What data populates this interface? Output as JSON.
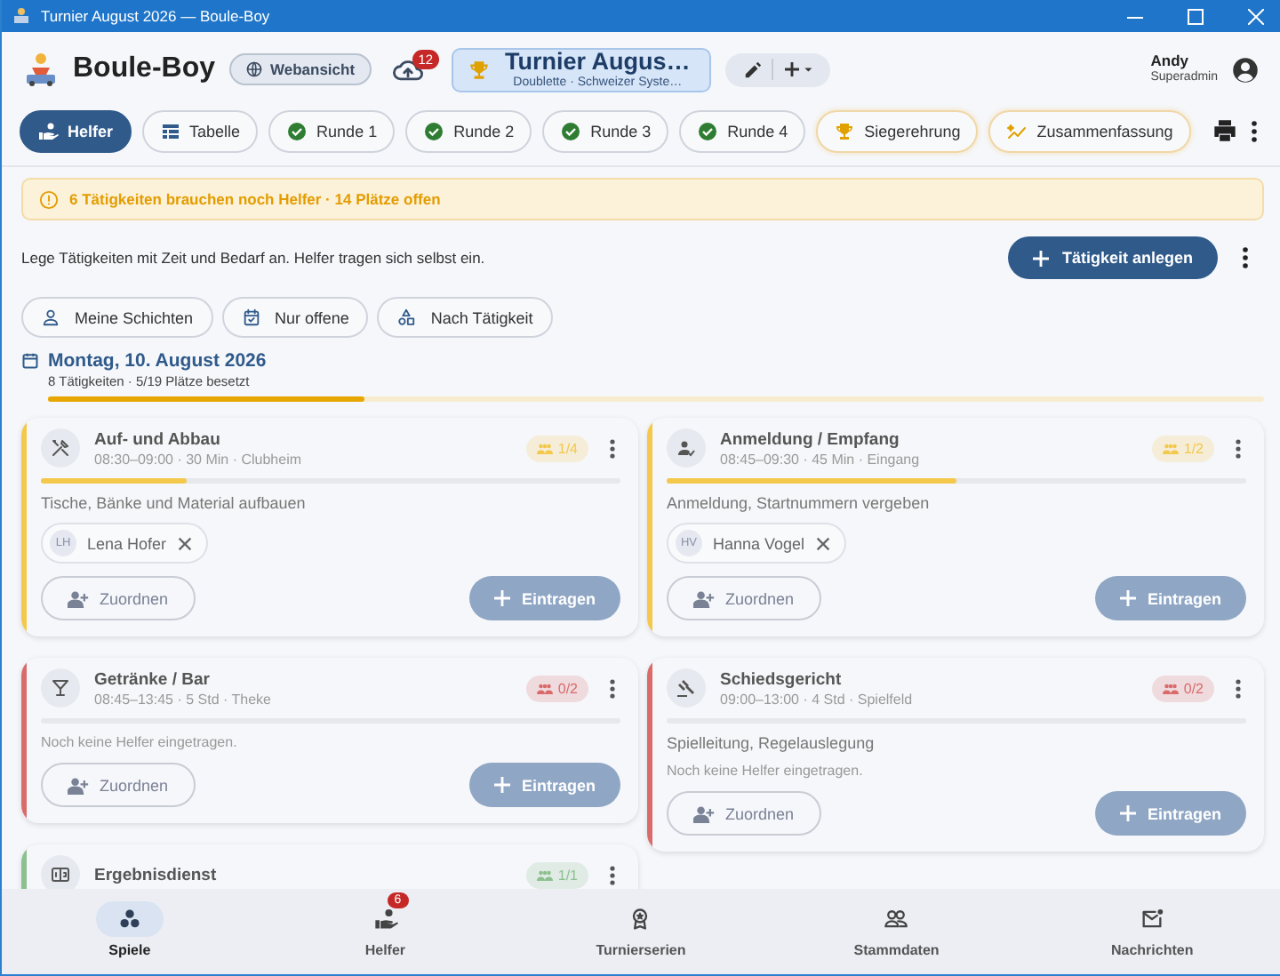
{
  "window": {
    "title": "Turnier August 2026 — Boule-Boy"
  },
  "header": {
    "app_name": "Boule-Boy",
    "web_button": "Webansicht",
    "sync_badge": "12",
    "tournament": {
      "title": "Turnier Augus…",
      "subtitle": "Doublette · Schweizer Syste…"
    },
    "user": {
      "name": "Andy",
      "role": "Superadmin"
    }
  },
  "tabs": [
    {
      "label": "Helfer",
      "kind": "helper",
      "selected": true
    },
    {
      "label": "Tabelle",
      "kind": "table",
      "selected": false
    },
    {
      "label": "Runde 1",
      "kind": "done",
      "selected": false
    },
    {
      "label": "Runde 2",
      "kind": "done",
      "selected": false
    },
    {
      "label": "Runde 3",
      "kind": "done",
      "selected": false
    },
    {
      "label": "Runde 4",
      "kind": "done",
      "selected": false
    },
    {
      "label": "Siegerehrung",
      "kind": "trophy",
      "selected": false
    },
    {
      "label": "Zusammenfassung",
      "kind": "summary",
      "selected": false
    }
  ],
  "alert": "6 Tätigkeiten brauchen noch Helfer · 14 Plätze offen",
  "intro": "Lege Tätigkeiten mit Zeit und Bedarf an. Helfer tragen sich selbst ein.",
  "add_button": "Tätigkeit anlegen",
  "filters": [
    {
      "label": "Meine Schichten",
      "kind": "person"
    },
    {
      "label": "Nur offene",
      "kind": "calendar"
    },
    {
      "label": "Nach Tätigkeit",
      "kind": "shapes"
    }
  ],
  "day": {
    "title": "Montag, 10. August 2026",
    "summary": "8 Tätigkeiten · 5/19 Plätze besetzt",
    "level": 0.26
  },
  "columns": [
    {
      "activities": [
        {
          "kind": "tools",
          "title": "Auf- und Abbau",
          "meta": "08:30–09:00 · 30 Min · Clubheim",
          "color": "#f4c84a",
          "count": "1/4",
          "level": 0.25,
          "description": "Tische, Bänke und Material aufbauen",
          "helpers": [
            {
              "initials": "LH",
              "name": "Lena Hofer"
            }
          ],
          "assign": "Zuordnen",
          "signup": "Eintragen"
        },
        {
          "kind": "glass",
          "title": "Getränke / Bar",
          "meta": "08:45–13:45 · 5 Std · Theke",
          "color": "#d96b6b",
          "count": "0/2",
          "level": 0,
          "empty_note": "Noch keine Helfer eingetragen.",
          "assign": "Zuordnen",
          "signup": "Eintragen"
        },
        {
          "kind": "board",
          "title": "Ergebnisdienst",
          "color": "#8cc08f",
          "count": "1/1"
        }
      ]
    },
    {
      "activities": [
        {
          "kind": "checkin",
          "title": "Anmeldung / Empfang",
          "meta": "08:45–09:30 · 45 Min · Eingang",
          "color": "#f4c84a",
          "count": "1/2",
          "level": 0.5,
          "description": "Anmeldung, Startnummern vergeben",
          "helpers": [
            {
              "initials": "HV",
              "name": "Hanna Vogel"
            }
          ],
          "assign": "Zuordnen",
          "signup": "Eintragen"
        },
        {
          "kind": "gavel",
          "title": "Schiedsgericht",
          "meta": "09:00–13:00 · 4 Std · Spielfeld",
          "color": "#d96b6b",
          "count": "0/2",
          "level": 0,
          "description": "Spielleitung, Regelauslegung",
          "empty_note": "Noch keine Helfer eingetragen.",
          "assign": "Zuordnen",
          "signup": "Eintragen"
        }
      ]
    }
  ],
  "bottom_nav": [
    {
      "label": "Spiele",
      "kind": "games",
      "selected": true
    },
    {
      "label": "Helfer",
      "kind": "helper",
      "selected": false,
      "badge": "6"
    },
    {
      "label": "Turnierserien",
      "kind": "medal",
      "selected": false
    },
    {
      "label": "Stammdaten",
      "kind": "people",
      "selected": false
    },
    {
      "label": "Nachrichten",
      "kind": "mail",
      "selected": false
    }
  ]
}
